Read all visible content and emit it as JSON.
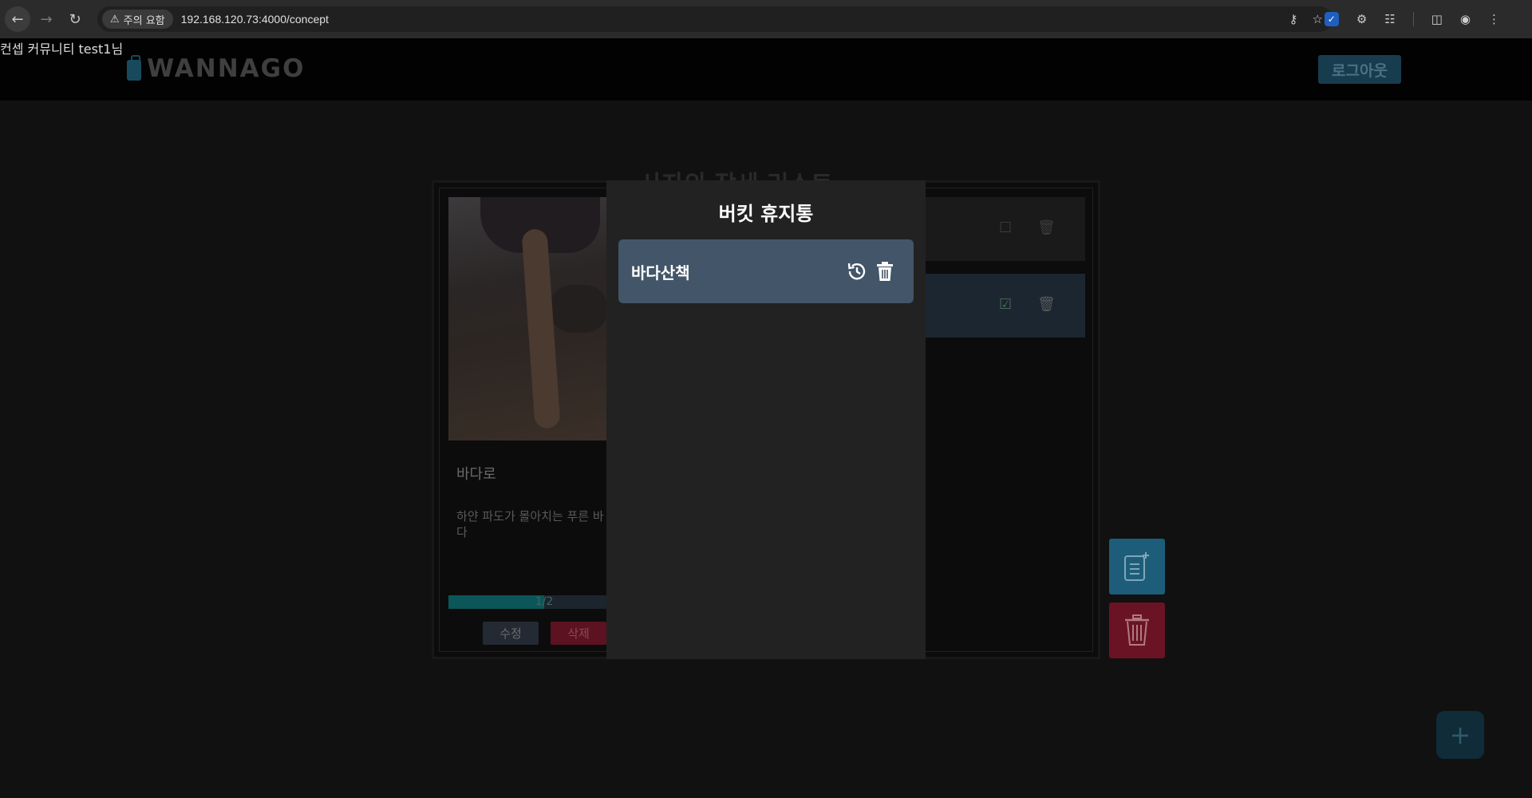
{
  "browser": {
    "security_label": "주의 요함",
    "url": "192.168.120.73:4000/concept"
  },
  "header": {
    "logo_text": "WANNAGO",
    "nav": {
      "concept": "컨셉",
      "community": "커뮤니티",
      "user": "test1님",
      "logout": "로그아웃"
    }
  },
  "page": {
    "title": "사자의 장세 리스트",
    "card": {
      "title": "바다로",
      "description": "하얀 파도가 몰아치는 푸른 바다",
      "progress_text": "1/2",
      "progress_fraction": 0.5,
      "edit_label": "수정",
      "delete_label": "삭제"
    }
  },
  "modal": {
    "title": "버킷 휴지통",
    "items": [
      {
        "label": "바다산책"
      }
    ]
  },
  "colors": {
    "accent": "#1e5d79",
    "danger": "#6a1324",
    "modal_item": "#435568"
  }
}
